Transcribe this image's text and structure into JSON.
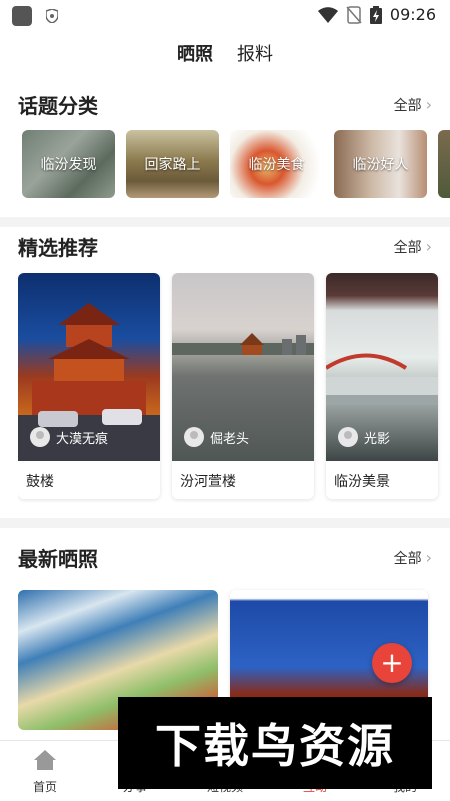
{
  "status_bar": {
    "time": "09:26"
  },
  "top_tabs": [
    {
      "label": "晒照",
      "active": true
    },
    {
      "label": "报料",
      "active": false
    }
  ],
  "topics": {
    "title": "话题分类",
    "more": "全部",
    "items": [
      {
        "label": "临汾发现"
      },
      {
        "label": "回家路上"
      },
      {
        "label": "临汾美食"
      },
      {
        "label": "临汾好人"
      }
    ]
  },
  "featured": {
    "title": "精选推荐",
    "more": "全部",
    "items": [
      {
        "author": "大漠无痕",
        "caption": "鼓楼"
      },
      {
        "author": "倔老头",
        "caption": "汾河萱楼"
      },
      {
        "author": "光影",
        "caption": "临汾美景"
      }
    ]
  },
  "latest": {
    "title": "最新晒照",
    "more": "全部"
  },
  "fab": "+",
  "bottom_nav": [
    {
      "label": "首页",
      "icon": "home-icon"
    },
    {
      "label": "办事",
      "icon": "service-icon"
    },
    {
      "label": "短视频",
      "icon": "video-icon"
    },
    {
      "label": "互动",
      "icon": "interact-icon"
    },
    {
      "label": "我的",
      "icon": "profile-icon"
    }
  ],
  "watermark": "下载鸟资源",
  "colors": {
    "accent": "#e8443a"
  }
}
